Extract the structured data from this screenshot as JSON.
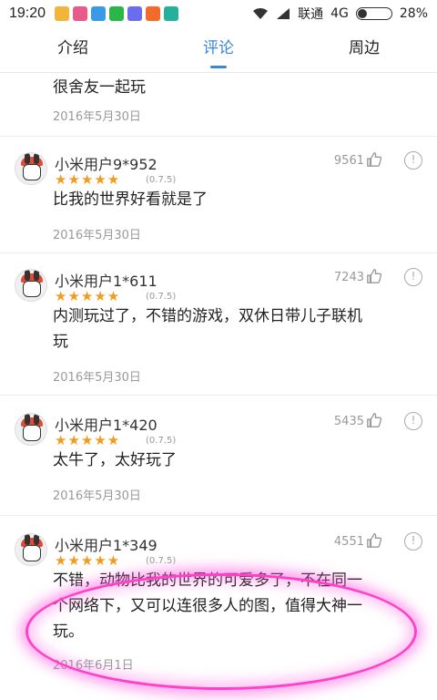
{
  "status_bar": {
    "time": "19:20",
    "carrier": "联通",
    "network": "4G",
    "battery": "28%",
    "battery_fraction": 0.28
  },
  "tabs": [
    {
      "label": "介绍",
      "active": false
    },
    {
      "label": "评论",
      "active": true
    },
    {
      "label": "周边",
      "active": false
    }
  ],
  "partial_review": {
    "text": "很舍友一起玩",
    "date": "2016年5月30日"
  },
  "reviews": [
    {
      "user": "小米用户9*952",
      "stars": "★★★★★",
      "version": "(0.7.5)",
      "likes": "9561",
      "lines": [
        "比我的世界好看就是了"
      ],
      "date": "2016年5月30日"
    },
    {
      "user": "小米用户1*611",
      "stars": "★★★★★",
      "version": "(0.7.5)",
      "likes": "7243",
      "lines": [
        "内测玩过了，不错的游戏，双休日带儿子联机",
        "玩"
      ],
      "date": "2016年5月30日"
    },
    {
      "user": "小米用户1*420",
      "stars": "★★★★★",
      "version": "(0.7.5)",
      "likes": "5435",
      "lines": [
        "太牛了，太好玩了"
      ],
      "date": "2016年5月30日"
    },
    {
      "user": "小米用户1*349",
      "stars": "★★★★★",
      "version": "(0.7.5)",
      "likes": "4551",
      "lines": [
        "不错，动物比我的世界的可爱多了，不在同一",
        "个网络下，又可以连很多人的图，值得大神一",
        "玩。"
      ],
      "date": "2016年6月1日"
    }
  ],
  "colors": {
    "accent": "#3a86d8",
    "star": "#f29b1d",
    "highlight": "#ff40c8"
  },
  "icons": {
    "like": "thumbs-up-icon",
    "more": "info-circle-icon",
    "signal": "wifi-icon"
  }
}
